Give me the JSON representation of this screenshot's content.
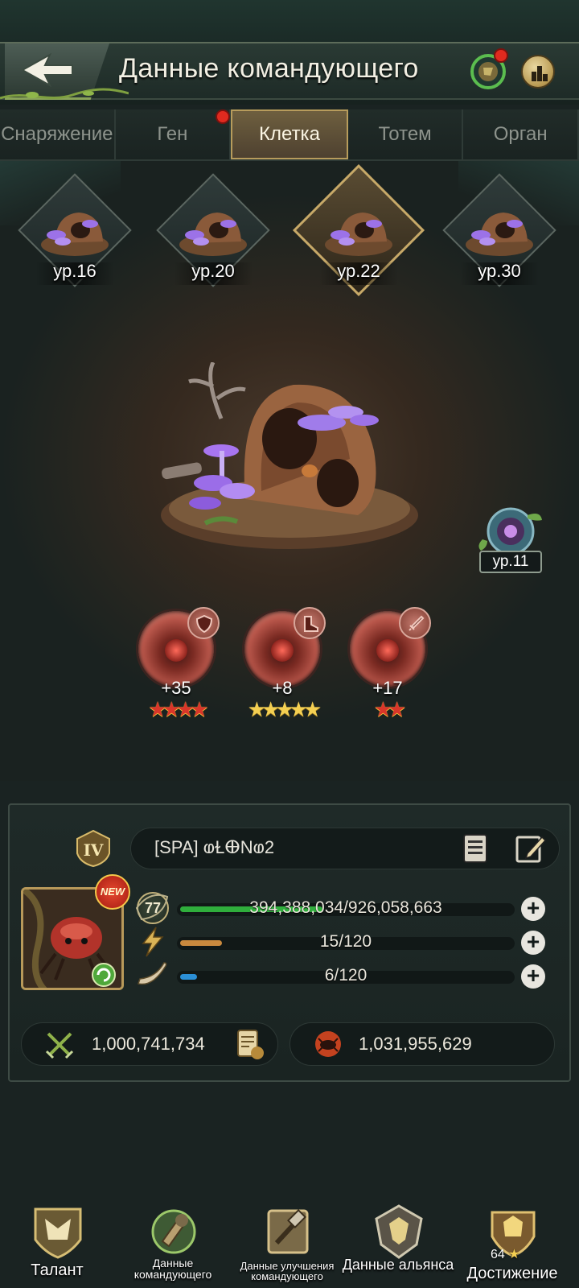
{
  "header": {
    "title": "Данные командующего",
    "back_label": "",
    "has_notification": true
  },
  "tabs": [
    {
      "label": "Снаряжение",
      "active": false
    },
    {
      "label": "Ген",
      "active": false,
      "has_notification": true
    },
    {
      "label": "Клетка",
      "active": true
    },
    {
      "label": "Тотем",
      "active": false
    },
    {
      "label": "Орган",
      "active": false
    }
  ],
  "cell_slots": [
    {
      "level": "ур.16",
      "active": false
    },
    {
      "level": "ур.20",
      "active": false
    },
    {
      "level": "ур.22",
      "active": true
    },
    {
      "level": "ур.30",
      "active": false
    }
  ],
  "organ_badge": {
    "level": "ур.11"
  },
  "gems": [
    {
      "bonus": "+35",
      "stars": 4,
      "star_color": "red",
      "type_icon": "shield-icon"
    },
    {
      "bonus": "+8",
      "stars": 5,
      "star_color": "gold",
      "type_icon": "boot-icon"
    },
    {
      "bonus": "+17",
      "stars": 2,
      "star_color": "red",
      "type_icon": "sword-icon"
    }
  ],
  "commander": {
    "rank": "IV",
    "name": "[SPA]  ⱷⱢⴲNⱷ2",
    "level": "77",
    "new_badge": "NEW",
    "stats": [
      {
        "icon": "leaf-icon",
        "text": "394,388,034/926,058,663",
        "fill": 0.43,
        "color": "#2fae3c"
      },
      {
        "icon": "lightning-icon",
        "text": "15/120",
        "fill": 0.125,
        "color": "#c9893e"
      },
      {
        "icon": "horn-icon",
        "text": "6/120",
        "fill": 0.05,
        "color": "#2b8fd6"
      }
    ],
    "power": "1,000,741,734",
    "kills": "1,031,955,629"
  },
  "bottom_nav": [
    {
      "label": "Талант",
      "icon": "talent-crest-icon"
    },
    {
      "label": "Данные командующего",
      "icon": "commander-data-icon"
    },
    {
      "label": "Данные улучшения командующего",
      "icon": "hammer-upgrade-icon"
    },
    {
      "label": "Данные альянса",
      "icon": "alliance-shield-icon"
    },
    {
      "label": "Достижение",
      "icon": "achievement-trophy-icon",
      "count": "64"
    }
  ],
  "colors": {
    "accent_gold": "#c7a968",
    "notify_red": "#e02a1f",
    "hp_green": "#2fae3c",
    "energy_orange": "#c9893e",
    "horn_blue": "#2b8fd6"
  }
}
